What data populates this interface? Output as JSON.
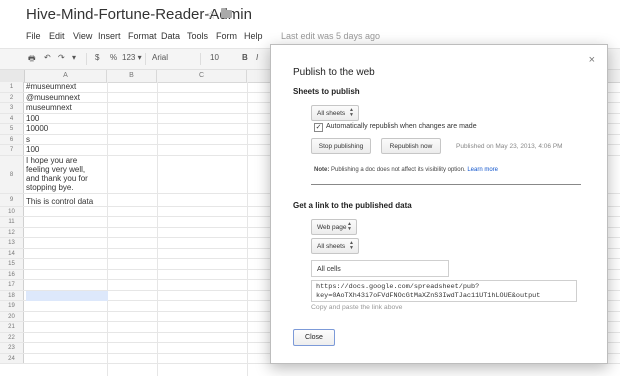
{
  "doc": {
    "title": "Hive-Mind-Fortune-Reader-Admin"
  },
  "menu": {
    "items": [
      "File",
      "Edit",
      "View",
      "Insert",
      "Format",
      "Data",
      "Tools",
      "Form",
      "Help"
    ],
    "last_edit": "Last edit was 5 days ago"
  },
  "toolbar": {
    "currency": "$",
    "percent": "%",
    "number_format": "123 ▾",
    "font": "Arial",
    "font_size": "10",
    "bold": "B"
  },
  "grid": {
    "columns": [
      "A",
      "B",
      "C"
    ],
    "rows": [
      {
        "num": "1",
        "a": "#museumnext"
      },
      {
        "num": "2",
        "a": "@museumnext"
      },
      {
        "num": "3",
        "a": "museumnext"
      },
      {
        "num": "4",
        "a": "100"
      },
      {
        "num": "5",
        "a": "10000"
      },
      {
        "num": "6",
        "a": "s"
      },
      {
        "num": "7",
        "a": "100"
      },
      {
        "num": "8",
        "a": "I hope you are\nfeeling very well,\nand thank you for\nstopping bye."
      },
      {
        "num": "9",
        "a": "This is control data"
      },
      {
        "num": "10",
        "a": ""
      },
      {
        "num": "11",
        "a": ""
      },
      {
        "num": "12",
        "a": ""
      },
      {
        "num": "13",
        "a": ""
      },
      {
        "num": "14",
        "a": ""
      },
      {
        "num": "15",
        "a": ""
      },
      {
        "num": "16",
        "a": ""
      },
      {
        "num": "17",
        "a": ""
      },
      {
        "num": "18",
        "a": ""
      },
      {
        "num": "19",
        "a": ""
      },
      {
        "num": "20",
        "a": ""
      },
      {
        "num": "21",
        "a": ""
      },
      {
        "num": "22",
        "a": ""
      },
      {
        "num": "23",
        "a": ""
      },
      {
        "num": "24",
        "a": ""
      }
    ]
  },
  "dialog": {
    "title": "Publish to the web",
    "close": "×",
    "sheets_section": "Sheets to publish",
    "sheets_select": "All sheets",
    "auto_republish_label": "Automatically republish when changes are made",
    "auto_republish_checked": true,
    "stop_button": "Stop publishing",
    "republish_button": "Republish now",
    "published_status": "Published on May 23, 2013, 4:06 PM",
    "note_bold": "Note:",
    "note_text": " Publishing a doc does not affect its visibility option. ",
    "learn_more": "Learn more",
    "link_section": "Get a link to the published data",
    "format_select": "Web page",
    "link_sheets_select": "All sheets",
    "range_value": "All cells",
    "url": "https://docs.google.com/spreadsheet/pub?\nkey=0AoTXh43i7oFVdFNOcGtMaXZnS3IwdTJac11UT1hLOUE&output",
    "url_hint": "Copy and paste the link above",
    "close_button": "Close"
  }
}
